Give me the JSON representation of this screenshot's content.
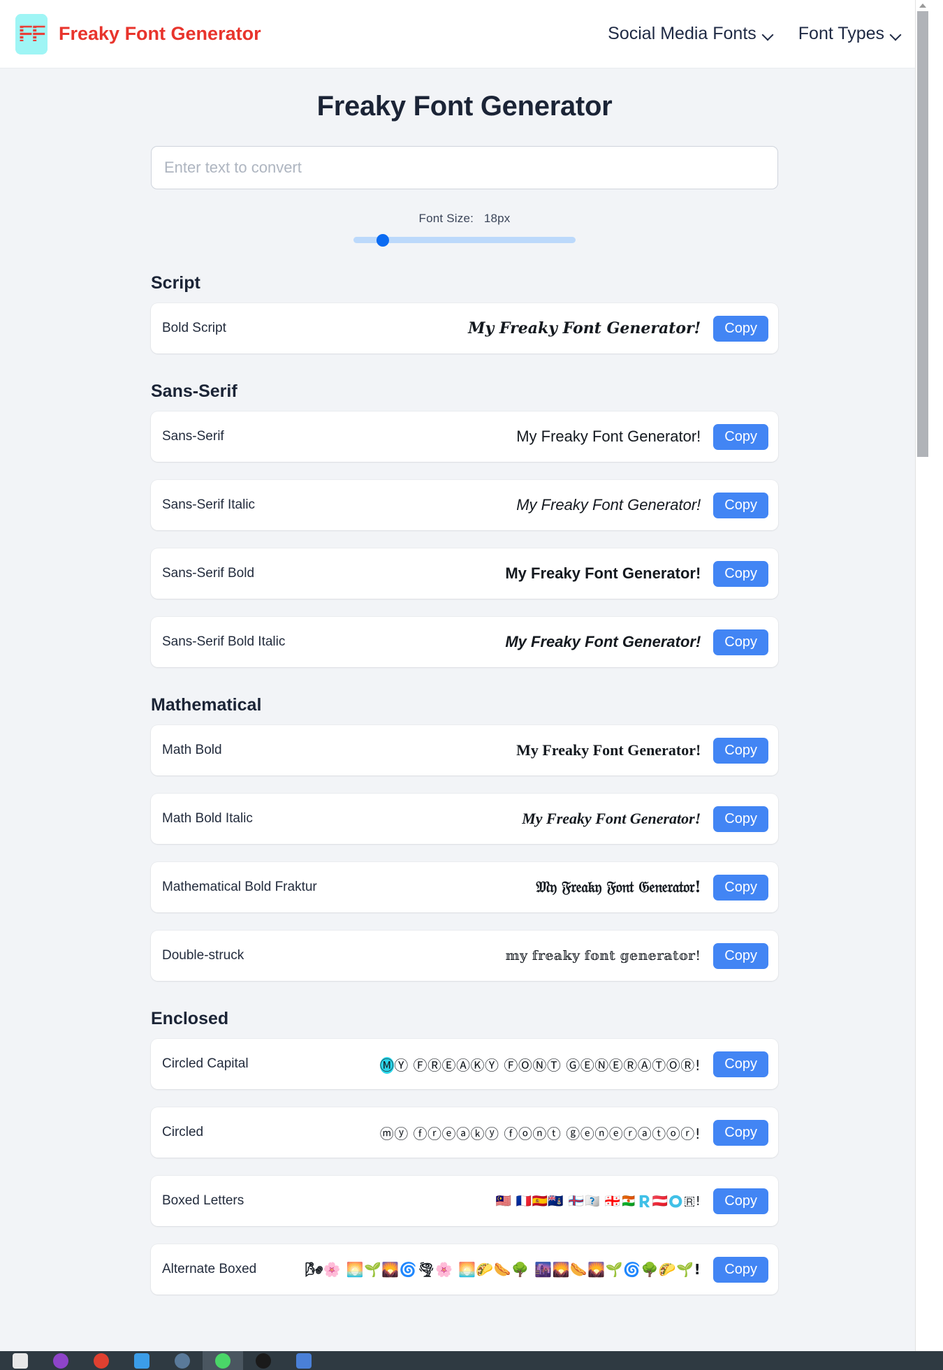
{
  "navbar": {
    "logo_alt": "FF",
    "brand_title": "Freaky Font Generator",
    "links": [
      {
        "label": "Social Media Fonts",
        "icon": "chevron-down-icon"
      },
      {
        "label": "Font Types",
        "icon": "chevron-down-icon"
      }
    ]
  },
  "page": {
    "title": "Freaky Font Generator"
  },
  "input": {
    "value": "",
    "placeholder": "Enter text to convert"
  },
  "font_size": {
    "label": "Font Size:",
    "value": "18px",
    "slider_percent": 11
  },
  "copy_label": "Copy",
  "colors": {
    "brand_red": "#e8342c",
    "logo_cyan": "#9ff5f5",
    "accent_blue": "#4285f4",
    "slider_blue": "#0b6bf2",
    "slider_track": "#bcd9fb",
    "page_bg": "#f2f4f7",
    "card_bg": "#ffffff",
    "text_dark": "#1b2436",
    "highlight_cyan": "#2ad4e8"
  },
  "sections": [
    {
      "heading": "Script",
      "rows": [
        {
          "label": "Bold Script",
          "sample": "My Freaky Font Generator!",
          "style": "s-script"
        }
      ]
    },
    {
      "heading": "Sans-Serif",
      "rows": [
        {
          "label": "Sans-Serif",
          "sample": "My Freaky Font Generator!",
          "style": "s-sans"
        },
        {
          "label": "Sans-Serif Italic",
          "sample": "My Freaky Font Generator!",
          "style": "s-sans-i"
        },
        {
          "label": "Sans-Serif Bold",
          "sample": "My Freaky Font Generator!",
          "style": "s-sans-b"
        },
        {
          "label": "Sans-Serif Bold Italic",
          "sample": "My Freaky Font Generator!",
          "style": "s-sans-bi"
        }
      ]
    },
    {
      "heading": "Mathematical",
      "rows": [
        {
          "label": "Math Bold",
          "sample": "My Freaky Font Generator!",
          "style": "s-serif-b"
        },
        {
          "label": "Math Bold Italic",
          "sample": "My Freaky Font Generator!",
          "style": "s-serif-bi"
        },
        {
          "label": "Mathematical Bold Fraktur",
          "sample": "𝔐𝔶 𝔉𝔯𝔢𝔞𝔨𝔶 𝔉𝔬𝔫𝔱 𝔊𝔢𝔫𝔢𝔯𝔞𝔱𝔬𝔯!",
          "style": "s-fraktur"
        },
        {
          "label": "Double-struck",
          "sample": "𝕞𝕪 𝕗𝕣𝕖𝕒𝕜𝕪 𝕗𝕠𝕟𝕥 𝕘𝕖𝕟𝕖𝕣𝕒𝕥𝕠𝕣!",
          "style": "s-dstruck"
        }
      ]
    },
    {
      "heading": "Enclosed",
      "rows": [
        {
          "label": "Circled Capital",
          "sample": "ⓂⓎ ⒻⓇⒺⒶⓀⓎ ⒻⓄⓃⓉ ⒼⒺⓃⒺⓇⒶⓉⓄⓇ!",
          "style": "s-circled",
          "highlight_first": true
        },
        {
          "label": "Circled",
          "sample": "ⓜⓨ ⓕⓡⓔⓐⓚⓨ ⓕⓞⓝⓣ ⓖⓔⓝⓔⓡⓐⓣⓞⓡ!",
          "style": "s-circled"
        },
        {
          "label": "Boxed Letters",
          "sample": "🇲🇾 🇫🇷🇪🇦🇰🇾 🇫🇴🇳🇹 🇬🇪🇳🇪🇷🇦🇹🇴🇷!",
          "style": "s-boxed"
        },
        {
          "label": "Alternate Boxed",
          "sample": "🌬🌸 🌅🌱🌄🌀🌪🌸 🌅🌮🌭🌳 🌆🌄🌭🌄🌱🌀🌳🌮🌱!",
          "style": "s-altboxed"
        }
      ]
    }
  ],
  "taskbar": {
    "icons": [
      {
        "name": "files-icon",
        "color": "#e8e8e8"
      },
      {
        "name": "media-player-icon",
        "color": "#8e44c9"
      },
      {
        "name": "chrome-icon",
        "color": "#e04030"
      },
      {
        "name": "telegram-icon",
        "color": "#3b9de8"
      },
      {
        "name": "gimp-icon",
        "color": "#5a7a9a"
      },
      {
        "name": "whatsapp-icon",
        "color": "#4ad668"
      },
      {
        "name": "terminal-icon",
        "color": "#1a1a1a"
      },
      {
        "name": "editor-icon",
        "color": "#4a80d8"
      }
    ],
    "active_index": 5
  }
}
